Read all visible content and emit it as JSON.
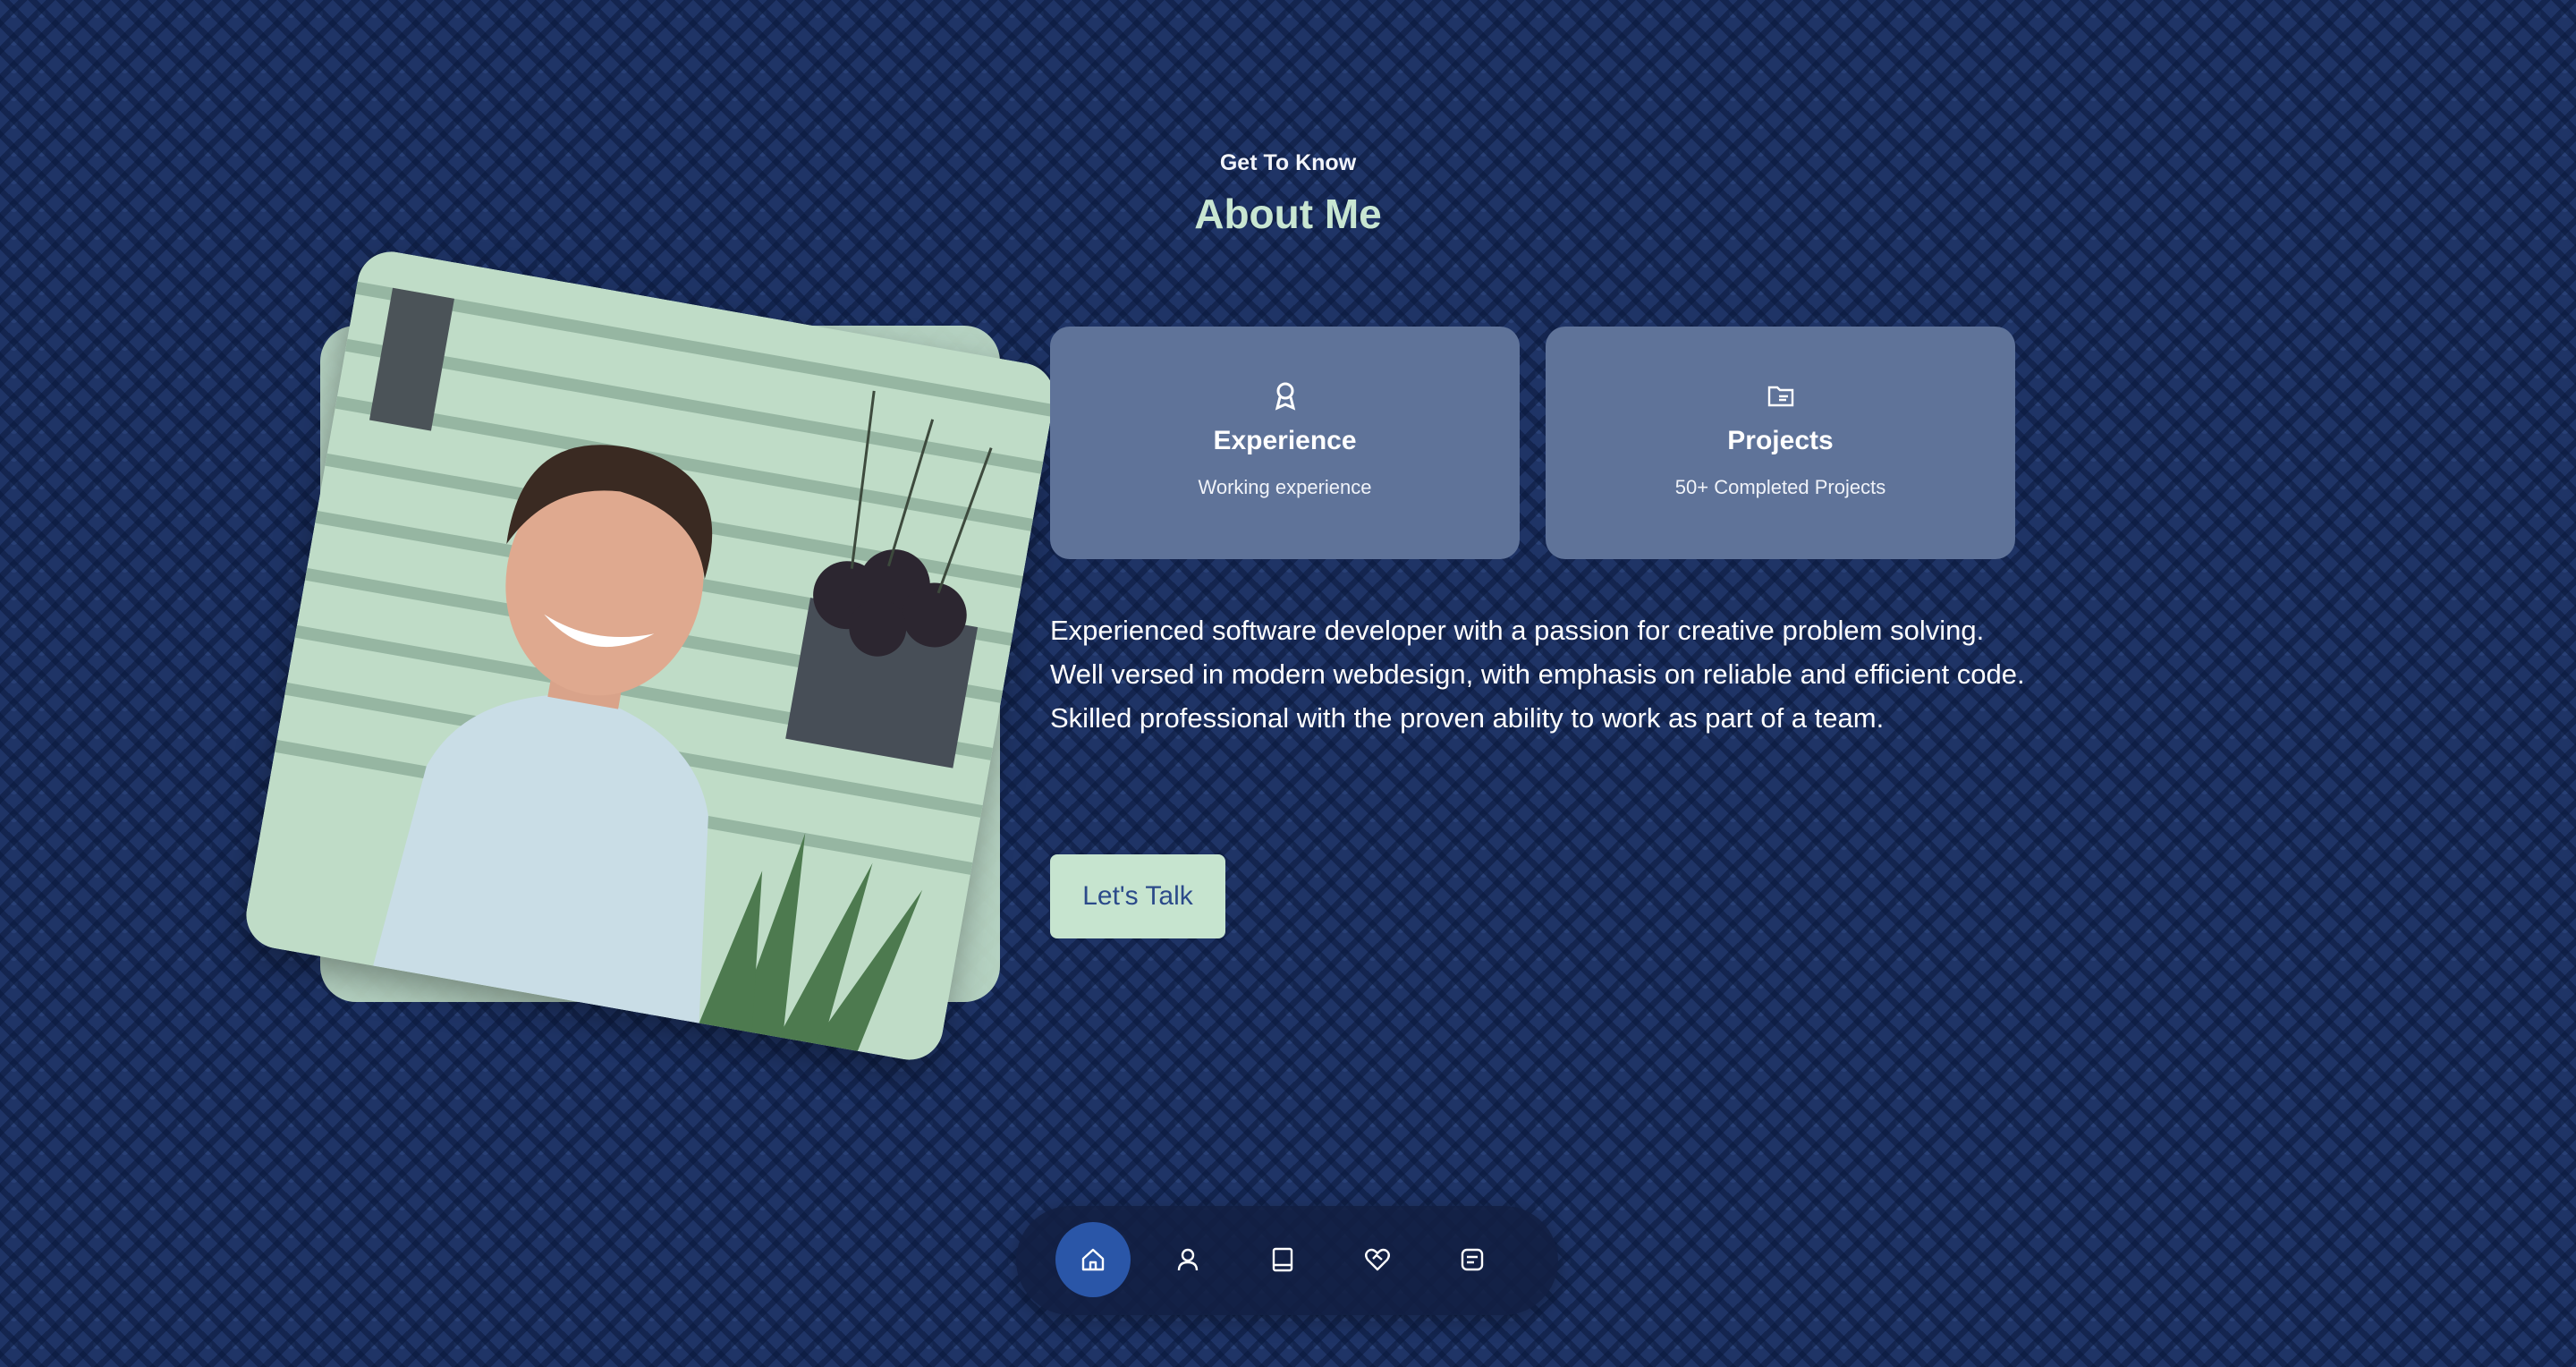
{
  "header": {
    "subtitle": "Get To Know",
    "title": "About Me"
  },
  "photo": {
    "icon": "portrait-photo"
  },
  "cards": [
    {
      "icon": "award-icon",
      "title": "Experience",
      "subtitle": "Working experience"
    },
    {
      "icon": "folder-icon",
      "title": "Projects",
      "subtitle": "50+ Completed Projects"
    }
  ],
  "bio": "Experienced software developer with a passion for creative problem solving. Well versed in modern webdesign, with emphasis on reliable and efficient code. Skilled professional with the proven ability to work as part of a team.",
  "cta": {
    "label": "Let's Talk"
  },
  "nav": {
    "items": [
      {
        "icon": "home-icon",
        "active": true
      },
      {
        "icon": "user-icon",
        "active": false
      },
      {
        "icon": "book-icon",
        "active": false
      },
      {
        "icon": "heart-handshake-icon",
        "active": false
      },
      {
        "icon": "message-icon",
        "active": false
      }
    ]
  },
  "colors": {
    "background": "#1f3466",
    "accent": "#c8e6d2",
    "card": "#5f7399",
    "nav_active": "#2a56a8",
    "button_text": "#2b4a8a"
  }
}
